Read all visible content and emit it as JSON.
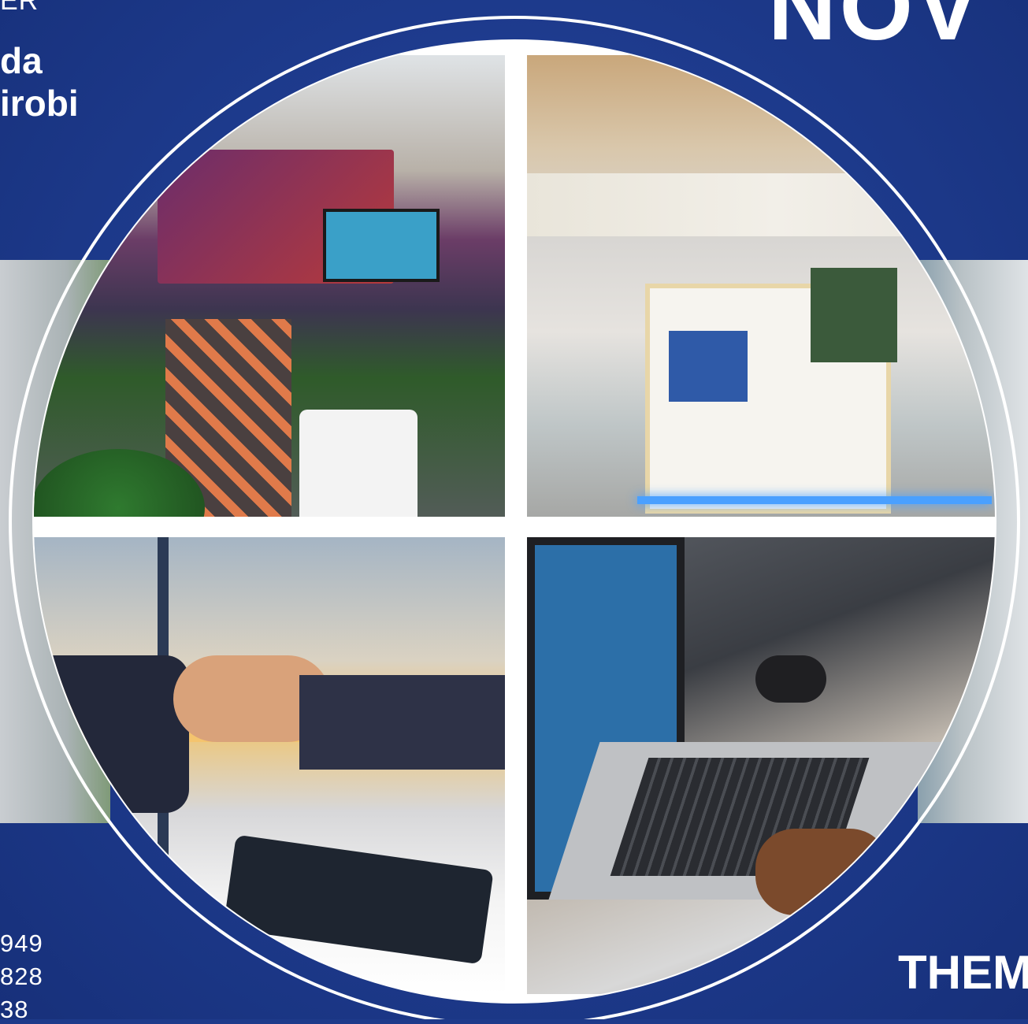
{
  "header_left": {
    "line1": "ER",
    "line2": "da",
    "line3": "irobi"
  },
  "header_right": {
    "month": "NOV"
  },
  "contacts": {
    "phone1": "949",
    "phone2": "828",
    "phone3": "38"
  },
  "footer_right": {
    "theme": "THEM"
  },
  "photos": {
    "top_left": "exhibition-booth-photo",
    "top_right": "exhibition-hall-photo",
    "bottom_left": "handshake-photo",
    "bottom_right": "laptop-photo"
  },
  "colors": {
    "background": "#1e3a8a",
    "ring": "#ffffff",
    "text": "#ffffff"
  }
}
